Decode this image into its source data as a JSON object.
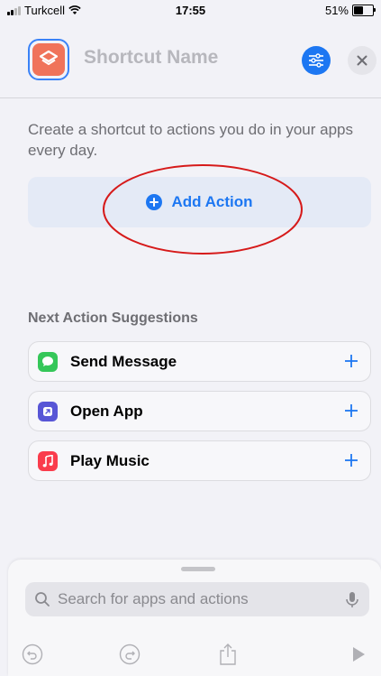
{
  "status_bar": {
    "carrier": "Turkcell",
    "time": "17:55",
    "battery": "51%",
    "battery_level": 0.51
  },
  "header": {
    "shortcut_name": "Shortcut Name",
    "icon_color": "#f0735a",
    "accent": "#1d77f2"
  },
  "main": {
    "intro": "Create a shortcut to actions you do in your apps every day.",
    "add_action_label": "Add Action",
    "suggestions_title": "Next Action Suggestions",
    "suggestions": [
      {
        "label": "Send Message",
        "icon": "messages-icon",
        "color": "#35c759"
      },
      {
        "label": "Open App",
        "icon": "open-app-icon",
        "color": "#5856d6"
      },
      {
        "label": "Play Music",
        "icon": "music-icon",
        "color": "#fa3c4c"
      }
    ]
  },
  "bottom": {
    "search_placeholder": "Search for apps and actions"
  }
}
